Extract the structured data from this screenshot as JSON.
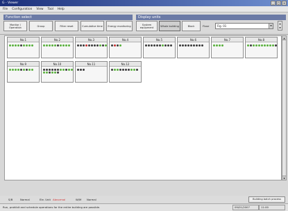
{
  "window": {
    "title": "G - Viewer",
    "controls": [
      "_",
      "□",
      "×"
    ]
  },
  "menu": [
    "File",
    "Configuration",
    "View",
    "Tool",
    "Help"
  ],
  "function_select": {
    "title": "Function select",
    "buttons": [
      "Monitor / Operation",
      "Group",
      "Filter reset",
      "Cumulative time",
      "Energy monitoring"
    ]
  },
  "display_units": {
    "title": "Display units",
    "buttons": [
      "System equipment",
      "Whole building",
      "Block",
      "Floor"
    ],
    "active": "Whole building",
    "floor_label": "Floor",
    "floor_value": "Fig. 01"
  },
  "tiles": [
    {
      "label": "No.1",
      "dots": [
        "g",
        "g",
        "g",
        "g",
        "d",
        "g",
        "g",
        "g",
        "g"
      ]
    },
    {
      "label": "No.2",
      "dots": [
        "g",
        "g",
        "g",
        "g",
        "g",
        "d",
        "g",
        "g",
        "g",
        "g"
      ]
    },
    {
      "label": "No.3",
      "dots": [
        "d",
        "d",
        "d",
        "r",
        "d",
        "d",
        "d",
        "d",
        "g",
        "d",
        "g"
      ]
    },
    {
      "label": "No.4",
      "dots": [
        "d",
        "r",
        "d",
        "g"
      ]
    },
    {
      "label": "No.5",
      "dots": [
        "d",
        "d",
        "d",
        "d",
        "d",
        "d",
        "g",
        "d",
        "d",
        "d"
      ]
    },
    {
      "label": "No.6",
      "dots": [
        "d",
        "d",
        "d",
        "d",
        "d",
        "d",
        "d",
        "d",
        "d"
      ]
    },
    {
      "label": "No.7",
      "dots": [
        "g",
        "g",
        "g",
        "g"
      ]
    },
    {
      "label": "No.8",
      "dots": [
        "g",
        "d",
        "g",
        "g",
        "g",
        "g",
        "g",
        "g",
        "g",
        "g",
        "d"
      ]
    },
    {
      "label": "No.9",
      "dots": [
        "g",
        "g",
        "g",
        "g",
        "d",
        "g",
        "d",
        "g",
        "g"
      ]
    },
    {
      "label": "No.10",
      "dots": [
        "d",
        "d",
        "d",
        "d",
        "d",
        "d",
        "g",
        "g",
        "d",
        "g",
        "g",
        "g",
        "g",
        "d",
        "g",
        "g",
        "d"
      ]
    },
    {
      "label": "No.11",
      "dots": [
        "d",
        "d",
        "d"
      ]
    },
    {
      "label": "No.12",
      "dots": [
        "d",
        "g",
        "g",
        "d",
        "d",
        "d",
        "d",
        "g",
        "g",
        "d"
      ]
    }
  ],
  "status": {
    "s": {
      "label": "S/B",
      "value": "Normal"
    },
    "e": {
      "label": "Ele. Unit",
      "value": "Abnormal"
    },
    "w": {
      "label": "W/M",
      "value": "Normal"
    },
    "button": "Building batch process"
  },
  "bottom": {
    "message": "Run, prohibit and schedule operations for the entire building are possible.",
    "date": "09/01/2007",
    "time": "11:00"
  },
  "colors": {
    "title_bar": "#1b2f7a",
    "group_header": "#6b7aa6",
    "dot_on": "#59b13d",
    "dot_off": "#3a3a3a",
    "dot_alarm": "#c73131"
  }
}
